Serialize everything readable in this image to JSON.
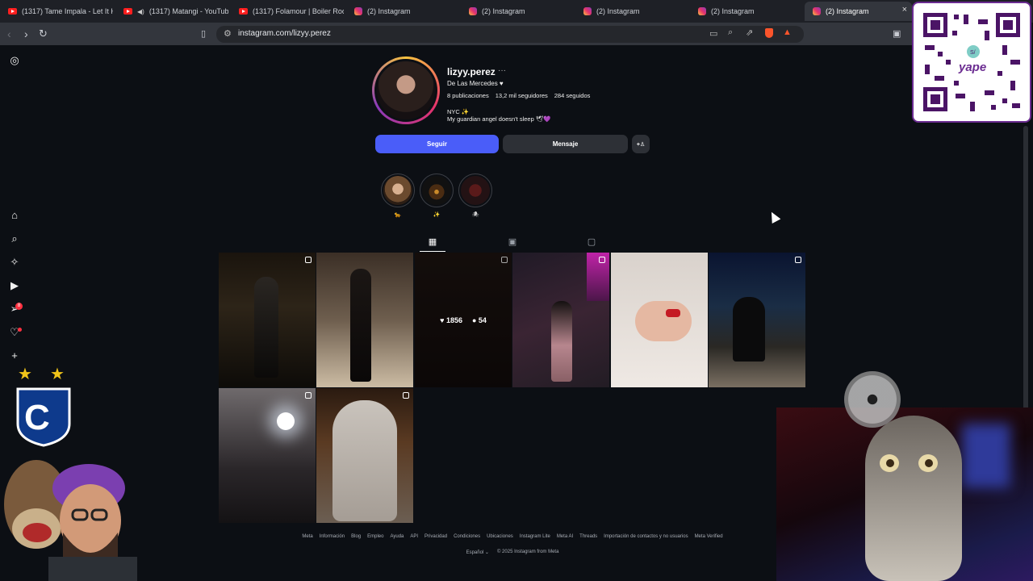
{
  "tabs": [
    {
      "title": "(1317) Tame Impala - Let It Hap",
      "favicon": "youtube-icon"
    },
    {
      "title": "(1317) Matangi - YouTube",
      "favicon": "youtube-icon",
      "muted": true
    },
    {
      "title": "(1317) Folamour | Boiler Room",
      "favicon": "youtube-icon"
    },
    {
      "title": "(2) Instagram",
      "favicon": "instagram-icon"
    },
    {
      "title": "(2) Instagram",
      "favicon": "instagram-icon"
    },
    {
      "title": "(2) Instagram",
      "favicon": "instagram-icon"
    },
    {
      "title": "(2) Instagram",
      "favicon": "instagram-icon"
    },
    {
      "title": "(2) Instagram",
      "favicon": "instagram-icon",
      "active": true
    }
  ],
  "address_bar": {
    "url": "instagram.com/lizyy.perez"
  },
  "sidebar": {
    "items": [
      "instagram-logo-icon",
      "home-icon",
      "search-icon",
      "explore-icon",
      "reels-icon",
      "messages-icon",
      "notifications-icon",
      "create-icon"
    ],
    "messages_badge": "8"
  },
  "profile": {
    "username": "lizyy.perez",
    "more": "···",
    "full_name": "De Las Mercedes ♥",
    "stats": {
      "posts": "8 publicaciones",
      "followers": "13,2 mil seguidores",
      "following": "284 seguidos"
    },
    "bio_line1": "NYC ✨",
    "bio_line2": "My guardian angel doesn't sleep 🕊💜",
    "buttons": {
      "follow": "Seguir",
      "message": "Mensaje",
      "add": "+R"
    },
    "highlights": [
      {
        "label": "🐆"
      },
      {
        "label": "✨"
      },
      {
        "label": "🕷"
      }
    ]
  },
  "content_tabs": [
    "posts-grid-icon",
    "reels-tab-icon",
    "tagged-icon"
  ],
  "posts": [
    {
      "multi": true
    },
    {
      "multi": false
    },
    {
      "multi": true,
      "likes": "1856",
      "comments": "54",
      "hover": true
    },
    {
      "multi": true
    },
    {
      "multi": false
    },
    {
      "multi": true
    },
    {
      "multi": true
    },
    {
      "multi": true
    }
  ],
  "footer": {
    "links": [
      "Meta",
      "Información",
      "Blog",
      "Empleo",
      "Ayuda",
      "API",
      "Privacidad",
      "Condiciones",
      "Ubicaciones",
      "Instagram Lite",
      "Meta AI",
      "Threads",
      "Importación de contactos y no usuarios",
      "Meta Verified"
    ],
    "language": "Español",
    "copyright": "© 2025 Instagram from Meta"
  },
  "overlays": {
    "qr_brand": "yape",
    "qr_badge": "S/"
  },
  "colors": {
    "follow_button": "#4a5df9",
    "background": "#0c0f14",
    "badge": "#ff3040"
  }
}
